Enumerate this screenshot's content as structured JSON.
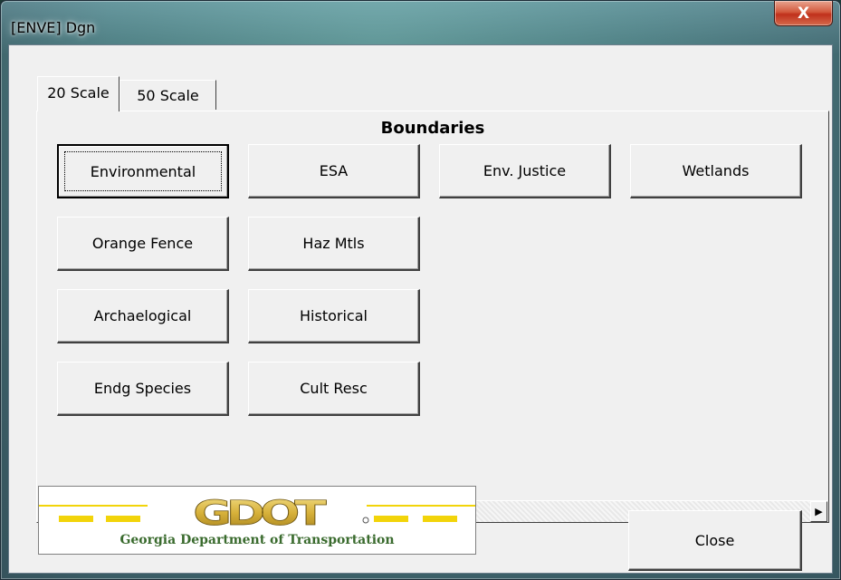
{
  "window": {
    "title": "[ENVE] Dgn",
    "close_glyph": "X"
  },
  "tabs": [
    {
      "label": "20 Scale",
      "active": true
    },
    {
      "label": "50 Scale",
      "active": false
    }
  ],
  "panel": {
    "heading": "Boundaries",
    "buttons": [
      "Environmental",
      "ESA",
      "Env. Justice",
      "Wetlands",
      "Orange Fence",
      "Haz Mtls",
      "Archaelogical",
      "Historical",
      "Endg Species",
      "Cult Resc"
    ],
    "scrollbar": {
      "left_arrow": "◀",
      "right_arrow": "▶"
    }
  },
  "logo": {
    "letters": "GDOT",
    "caption": "Georgia Department of Transportation",
    "colors": {
      "gold": "#d7b13a",
      "yellow": "#f2d40a",
      "green": "#3a6b2e"
    }
  },
  "footer": {
    "close_label": "Close"
  }
}
